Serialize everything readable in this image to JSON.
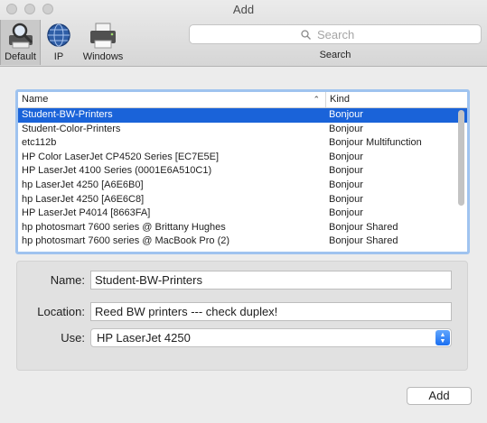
{
  "window": {
    "title": "Add"
  },
  "toolbar": {
    "items": [
      {
        "label": "Default",
        "icon": "magnifier-printer-icon",
        "selected": true
      },
      {
        "label": "IP",
        "icon": "globe-icon",
        "selected": false
      },
      {
        "label": "Windows",
        "icon": "printer-icon",
        "selected": false
      }
    ],
    "search": {
      "placeholder": "Search",
      "caption": "Search"
    }
  },
  "list": {
    "columns": {
      "name": "Name",
      "kind": "Kind"
    },
    "sort": "ascending-by-name",
    "rows": [
      {
        "name": "Student-BW-Printers",
        "kind": "Bonjour",
        "selected": true
      },
      {
        "name": "Student-Color-Printers",
        "kind": "Bonjour"
      },
      {
        "name": "etc112b",
        "kind": "Bonjour Multifunction"
      },
      {
        "name": "HP Color LaserJet CP4520 Series [EC7E5E]",
        "kind": "Bonjour"
      },
      {
        "name": "HP LaserJet 4100 Series (0001E6A510C1)",
        "kind": "Bonjour"
      },
      {
        "name": "hp LaserJet 4250 [A6E6B0]",
        "kind": "Bonjour"
      },
      {
        "name": "hp LaserJet 4250 [A6E6C8]",
        "kind": "Bonjour"
      },
      {
        "name": "HP LaserJet P4014 [8663FA]",
        "kind": "Bonjour"
      },
      {
        "name": "hp photosmart 7600 series @ Brittany Hughes",
        "kind": "Bonjour Shared"
      },
      {
        "name": "hp photosmart 7600 series @ MacBook Pro (2)",
        "kind": "Bonjour Shared"
      }
    ]
  },
  "form": {
    "name_label": "Name:",
    "name_value": "Student-BW-Printers",
    "location_label": "Location:",
    "location_value": "Reed BW printers --- check duplex!",
    "use_label": "Use:",
    "use_value": "HP LaserJet 4250"
  },
  "buttons": {
    "add": "Add"
  },
  "colors": {
    "selection": "#1a63d9",
    "focus_ring": "#9fc3ef"
  }
}
